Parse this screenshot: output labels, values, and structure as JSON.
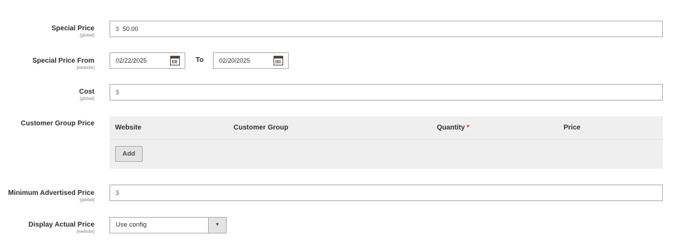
{
  "special_price": {
    "label": "Special Price",
    "scope": "[global]",
    "currency": "$",
    "value": "50.00"
  },
  "special_price_from": {
    "label": "Special Price From",
    "scope": "[website]",
    "from_value": "02/22/2025",
    "to_label": "To",
    "to_value": "02/20/2025"
  },
  "cost": {
    "label": "Cost",
    "scope": "[global]",
    "currency": "$",
    "value": ""
  },
  "customer_group_price": {
    "label": "Customer Group Price",
    "columns": {
      "website": "Website",
      "customer_group": "Customer Group",
      "quantity": "Quantity",
      "required_mark": "*",
      "price": "Price"
    },
    "add_label": "Add"
  },
  "map": {
    "label": "Minimum Advertised Price",
    "scope": "[global]",
    "currency": "$",
    "value": ""
  },
  "display_actual_price": {
    "label": "Display Actual Price",
    "scope": "[website]",
    "selected": "Use config",
    "arrow": "▼"
  },
  "icons": {
    "calendar": "calendar-icon",
    "dropdown": "chevron-down-icon"
  },
  "colors": {
    "required": "#e22626",
    "table_bg": "#efefef",
    "border": "#adadad"
  }
}
